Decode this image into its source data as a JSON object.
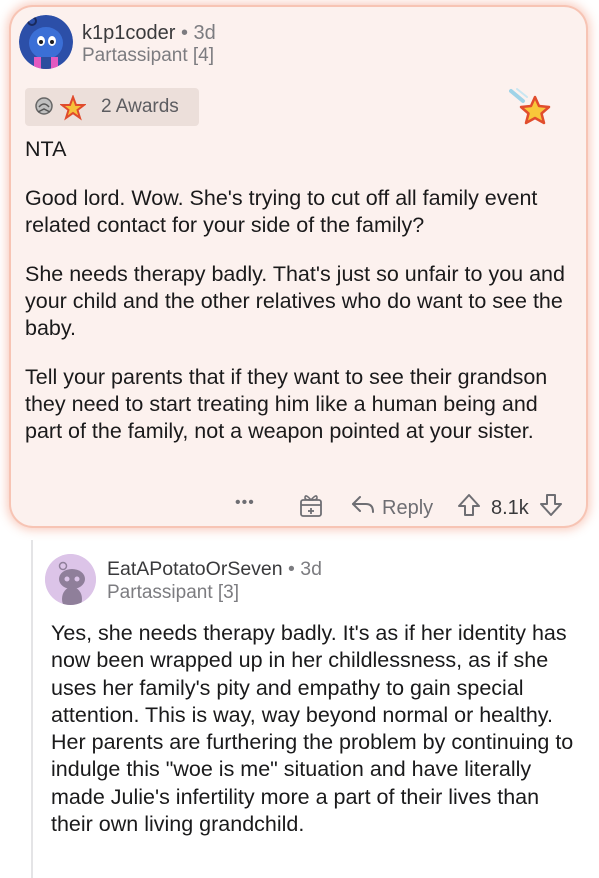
{
  "comment1": {
    "username": "k1p1coder",
    "separator": "•",
    "time": "3d",
    "flair": "Partassipant [4]",
    "awards_label": "2 Awards",
    "paragraphs": [
      "NTA",
      "Good lord. Wow. She's trying to cut off all family event related contact for your side of the family?",
      "She needs therapy badly. That's just so unfair to you and your child and the other relatives who do want to see the baby.",
      "Tell your parents that if they want to see their grandson they need to start treating him like a human being and part of the family, not a weapon pointed at your sister."
    ],
    "actions": {
      "more": "•••",
      "reply": "Reply",
      "score": "8.1k"
    }
  },
  "comment2": {
    "username": "EatAPotatoOrSeven",
    "separator": "•",
    "time": "3d",
    "flair": "Partassipant [3]",
    "paragraphs": [
      "Yes, she needs therapy badly. It's as if her identity has now been wrapped up in her childlessness, as if she uses her family's pity and empathy to gain special attention. This is way, way beyond normal or healthy. Her parents are furthering the problem by continuing to indulge this \"woe is me\" situation and have literally made Julie's infertility more a part of their lives than their own living grandchild."
    ]
  },
  "icons": [
    "avatar-kiwi",
    "silver-award-icon",
    "star-award-icon",
    "gold-star-award-icon",
    "more-icon",
    "give-award-icon",
    "reply-icon",
    "upvote-icon",
    "downvote-icon",
    "avatar-snoo"
  ],
  "colors": {
    "highlight_bg": "#fcf1ee",
    "highlight_border": "#f7c4b4",
    "text": "#1a1a1b",
    "meta": "#7c7c80",
    "award_chip": "#ecdfda"
  }
}
